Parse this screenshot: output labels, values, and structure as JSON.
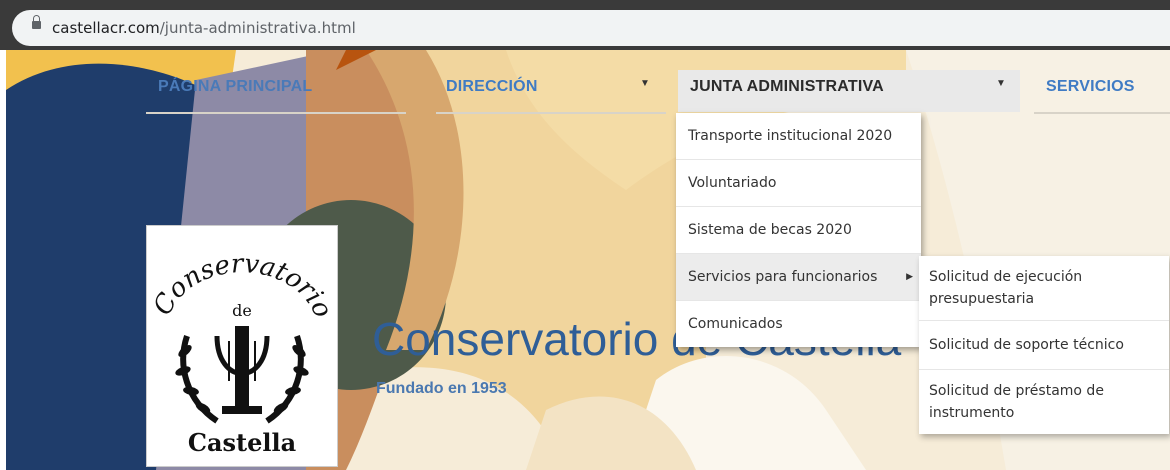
{
  "browser": {
    "url_domain": "castellacr.com",
    "url_path": "/junta-administrativa.html"
  },
  "nav": {
    "items": [
      {
        "label": "PÁGINA PRINCIPAL"
      },
      {
        "label": "DIRECCIÓN"
      },
      {
        "label": "JUNTA ADMINISTRATIVA"
      },
      {
        "label": "SERVICIOS"
      }
    ]
  },
  "dropdown": {
    "items": [
      {
        "label": "Transporte institucional 2020"
      },
      {
        "label": "Voluntariado"
      },
      {
        "label": "Sistema de becas 2020"
      },
      {
        "label": "Servicios para funcionarios"
      },
      {
        "label": "Comunicados"
      }
    ]
  },
  "submenu": {
    "items": [
      {
        "label": "Solicitud de ejecución presupuestaria"
      },
      {
        "label": "Solicitud de soporte técnico"
      },
      {
        "label": "Solicitud de préstamo de instrumento"
      }
    ]
  },
  "hero": {
    "title": "Conservatorio de Castella",
    "subtitle": "Fundado en 1953"
  },
  "logo": {
    "top_text": "Conservatorio",
    "middle_text": "de",
    "bottom_text": "Castella"
  },
  "colors": {
    "nav_link": "#3f7bc4",
    "title": "#2f5e97",
    "hero_navy": "#1f3d6b",
    "hero_yellow": "#f2c14e"
  }
}
